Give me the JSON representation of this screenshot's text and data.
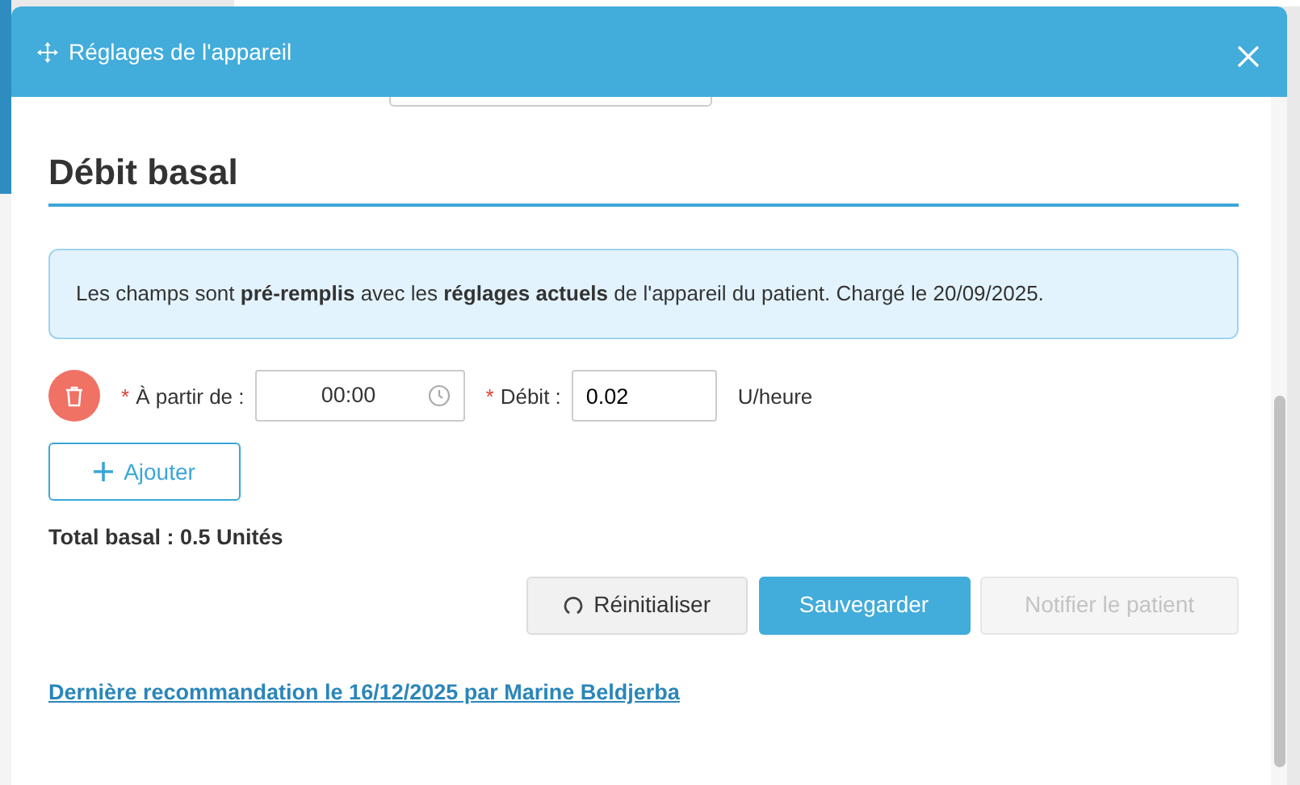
{
  "dialog": {
    "title": "Réglages de l'appareil"
  },
  "section": {
    "title": "Débit basal"
  },
  "info": "Les champs sont **pré-remplis** avec les **réglages actuels** de l'appareil du patient. Chargé le 20/09/2025.",
  "rows": [
    {
      "start_mark": "*",
      "start_label": "À partir de :",
      "start_value": "00:00",
      "rate_mark": "*",
      "rate_label": "Débit :",
      "rate_value": "0.02",
      "unit": "U/heure"
    }
  ],
  "add_button": "Ajouter",
  "total": "Total basal : 0.5 Unités",
  "buttons": [
    {
      "kind": "secondary",
      "label": "Réinitialiser",
      "disabled": false
    },
    {
      "kind": "primary",
      "label": "Sauvegarder",
      "disabled": false
    },
    {
      "kind": "secondary",
      "label": "Notifier le patient",
      "disabled": true
    }
  ],
  "footer_link": "Dernière recommandation le 16/12/2025 par Marine Beldjerba"
}
